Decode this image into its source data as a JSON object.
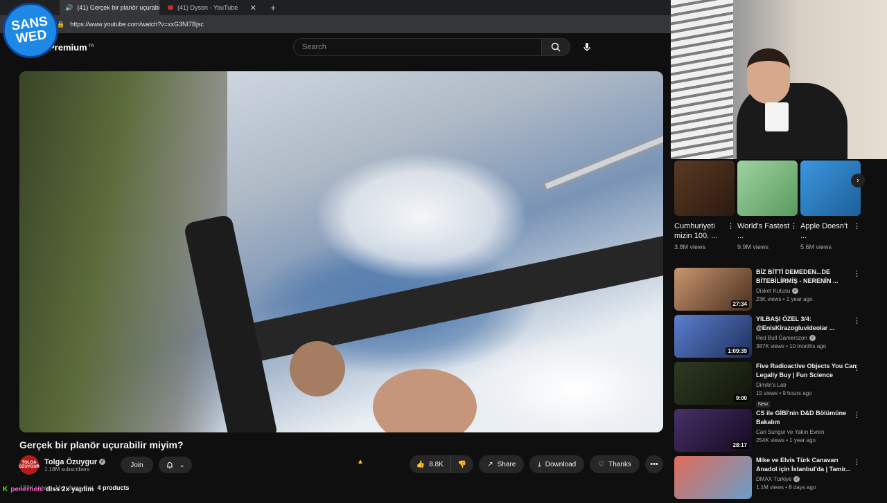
{
  "browser": {
    "tabs": [
      {
        "label": "(41) Gerçek bir planör uçurabilir miyim? - YouTube",
        "active": true
      },
      {
        "label": "(41) Dyson - YouTube",
        "active": false
      }
    ],
    "url": "https://www.youtube.com/watch?v=xxG3NI7Bjsc"
  },
  "overlay_logo": {
    "line1": "SANS",
    "line2": "WED"
  },
  "header": {
    "brand": "Premium",
    "region": "TR",
    "search_placeholder": "Search"
  },
  "video": {
    "title": "Gerçek bir planör uçurabilir miyim?",
    "channel": {
      "name": "Tolga Özuygur",
      "subscribers": "1.18M subscribers",
      "avatar_text": "TOLGA ÖZUYGUR"
    },
    "join_label": "Join",
    "likes": "8.8K",
    "share_label": "Share",
    "download_label": "Download",
    "thanks_label": "Thanks",
    "meta": {
      "views": "189K views",
      "members": "Members first",
      "products": "4 products"
    }
  },
  "stream_chat": {
    "user": "penernen:",
    "message": "dlss 2x yaptim"
  },
  "shorts": [
    {
      "title": "Cumhuriyeti mizin 100. ...",
      "views": "3.8M views",
      "color": "#5a3a22"
    },
    {
      "title": "World's Fastest ...",
      "views": "9.9M views",
      "color": "#7bb87e"
    },
    {
      "title": "Apple Doesn't ...",
      "views": "5.6M views",
      "color": "#2e7fcb"
    }
  ],
  "recommendations": [
    {
      "title": "BİZ BİTTİ DEMEDEN...DE BİTEBİLİRMİŞ - NERENİN ...",
      "channel": "Disket Kutusu",
      "meta": "23K views • 1 year ago",
      "duration": "27:34",
      "color": "#8a5b3a",
      "verified": true,
      "is_new": false
    },
    {
      "title": "YILBAŞI ÖZEL 3/4: @EnisKirazogluvideolar ...",
      "channel": "Red Bull Gamerszon",
      "meta": "387K views • 10 months ago",
      "duration": "1:09:39",
      "color": "#3d5fa8",
      "verified": true,
      "is_new": false
    },
    {
      "title": "Five Radioactive Objects You Can Legally Buy | Fun Science",
      "channel": "Dimitri's Lab",
      "meta": "15 views • 9 hours ago",
      "duration": "9:00",
      "color": "#1f2a1a",
      "verified": false,
      "is_new": true,
      "new_label": "New"
    },
    {
      "title": "CS ile GİBİ'nin D&D Bölümüne Bakalım",
      "channel": "Can Sungur ve Yakın Evren",
      "meta": "254K views • 1 year ago",
      "duration": "28:17",
      "color": "#2a1f3a",
      "verified": false,
      "is_new": false
    },
    {
      "title": "Mike ve Elvis Türk Canavarı Anadol için İstanbul'da | Tamir...",
      "channel": "DMAX Türkiye",
      "meta": "1.1M views • 8 days ago",
      "duration": "",
      "color": "#b8443a",
      "verified": true,
      "is_new": false
    }
  ]
}
